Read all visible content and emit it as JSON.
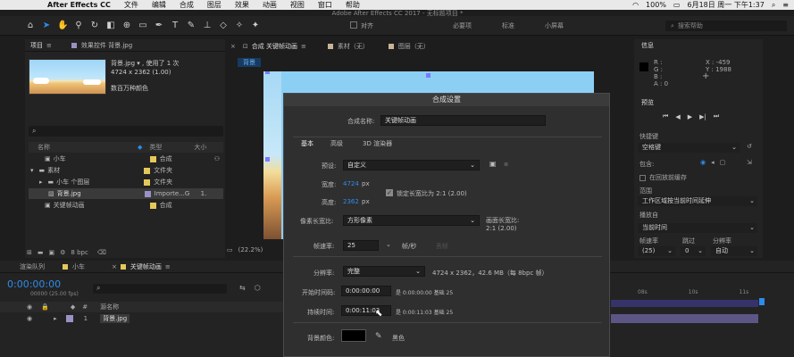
{
  "menubar": {
    "apple": "",
    "app_name": "After Effects CC",
    "items": [
      "文件",
      "编辑",
      "合成",
      "图层",
      "效果",
      "动画",
      "视图",
      "窗口",
      "帮助"
    ],
    "status": {
      "battery": "100%",
      "datetime": "6月18日 周一 下午1:37"
    }
  },
  "window_title": "Adobe After Effects CC 2017 - 无标题项目 *",
  "toolbar": {
    "align_label": "对齐",
    "workspaces": [
      "必要项",
      "标准",
      "小屏幕"
    ],
    "search_placeholder": "搜索帮助"
  },
  "project_panel": {
    "tabs": [
      "项目",
      "效果控件 背景.jpg"
    ],
    "file_name": "背景.jpg ▾ , 使用了 1 次",
    "dimensions": "4724 x 2362 (1.00)",
    "colors": "数百万种颜色",
    "columns": {
      "name": "名称",
      "type": "类型",
      "size": "大小"
    },
    "items": [
      {
        "name": "小车",
        "type": "合成",
        "color": "#e5c85a",
        "indent": 0
      },
      {
        "name": "素材",
        "type": "文件夹",
        "color": "#e5c85a",
        "indent": 0
      },
      {
        "name": "小车 个图层",
        "type": "文件夹",
        "color": "#e5c85a",
        "indent": 1
      },
      {
        "name": "背景.jpg",
        "type": "Importe...G",
        "size": "1.",
        "color": "#9a92c4",
        "indent": 1
      },
      {
        "name": "关键帧动画",
        "type": "合成",
        "color": "#e5c85a",
        "indent": 0
      }
    ],
    "bpc": "8 bpc"
  },
  "comp_panel": {
    "tab_label": "合成 关键帧动画",
    "footage_tab": "素材（无）",
    "layer_tab": "图层（无）",
    "breadcrumb": "背景",
    "zoom": "(22.2%)"
  },
  "dialog": {
    "title": "合成设置",
    "comp_name_label": "合成名称:",
    "comp_name": "关键帧动画",
    "tabs": [
      "基本",
      "高级",
      "3D 渲染器"
    ],
    "preset_label": "预设:",
    "preset": "自定义",
    "width_label": "宽度:",
    "width": "4724",
    "height_label": "高度:",
    "height": "2362",
    "px": "px",
    "lock_aspect": "锁定长宽比为 2:1 (2.00)",
    "pixel_aspect_label": "像素长宽比:",
    "pixel_aspect": "方形像素",
    "frame_aspect_label": "画面长宽比:",
    "frame_aspect": "2:1 (2.00)",
    "fps_label": "帧速率:",
    "fps": "25",
    "fps_unit": "帧/秒",
    "fps_drop": "丢帧",
    "resolution_label": "分辨率:",
    "resolution": "完整",
    "resolution_info": "4724 x 2362，42.6 MB（每 8bpc 帧）",
    "start_label": "开始时间码:",
    "start": "0:00:00:00",
    "start_info": "是 0:00:00:00  基础 25",
    "duration_label": "持续时间:",
    "duration": "0:00:11:03",
    "duration_info": "是 0:00:11:03  基础 25",
    "bg_label": "背景颜色:",
    "bg_name": "黑色"
  },
  "info_panel": {
    "title": "信息",
    "r": "R :",
    "g": "G :",
    "b": "B :",
    "a": "A : 0",
    "x": "X : -459",
    "y": "Y : 1988",
    "preview_title": "预览",
    "shortcut_label": "快捷键",
    "shortcut": "空格键",
    "include_label": "包含:",
    "cache_label": "在回放前缓存",
    "range_label": "范围",
    "range": "工作区域按当前时间延伸",
    "play_from_label": "播放自",
    "play_from": "当前时间",
    "fps_label": "帧速率",
    "skip_label": "跳过",
    "res_label": "分辨率",
    "fps": "(25)",
    "skip": "0",
    "res": "自动"
  },
  "timeline": {
    "tabs": [
      "渲染队列",
      "小车",
      "关键帧动画"
    ],
    "timecode": "0:00:00:00",
    "timecode_sub": "00000 (25.00 fps)",
    "layer_col": "源名称",
    "layer_index": "1",
    "layer_name": "背景.jpg",
    "ruler": [
      "08s",
      "10s",
      "11s"
    ]
  }
}
